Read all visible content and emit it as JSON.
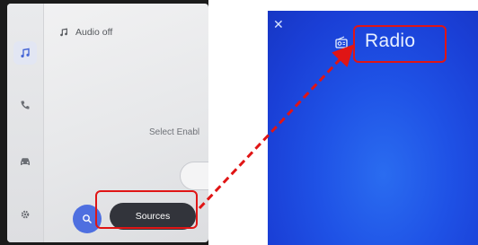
{
  "left_screen": {
    "audio_header": {
      "icon": "music-note-icon",
      "text": "Audio off"
    },
    "side_rail": [
      {
        "icon": "music-note-icon",
        "active": true
      },
      {
        "icon": "phone-icon",
        "active": false
      },
      {
        "icon": "car-icon",
        "active": false
      },
      {
        "icon": "settings-gear-icon",
        "active": false
      }
    ],
    "select_text": "Select Enabl",
    "search_button_icon": "search-icon",
    "sources_button_label": "Sources"
  },
  "right_screen": {
    "close_icon": "close-icon",
    "radio_icon": "radio-icon",
    "title": "Radio"
  },
  "annotation": {
    "highlight_color": "#e01515",
    "arrow_color": "#e01515",
    "arrow_style": "dashed"
  },
  "colors": {
    "accent_blue": "#4e6fe0",
    "radio_background": "#1f52e6",
    "sources_button": "#32343b"
  }
}
